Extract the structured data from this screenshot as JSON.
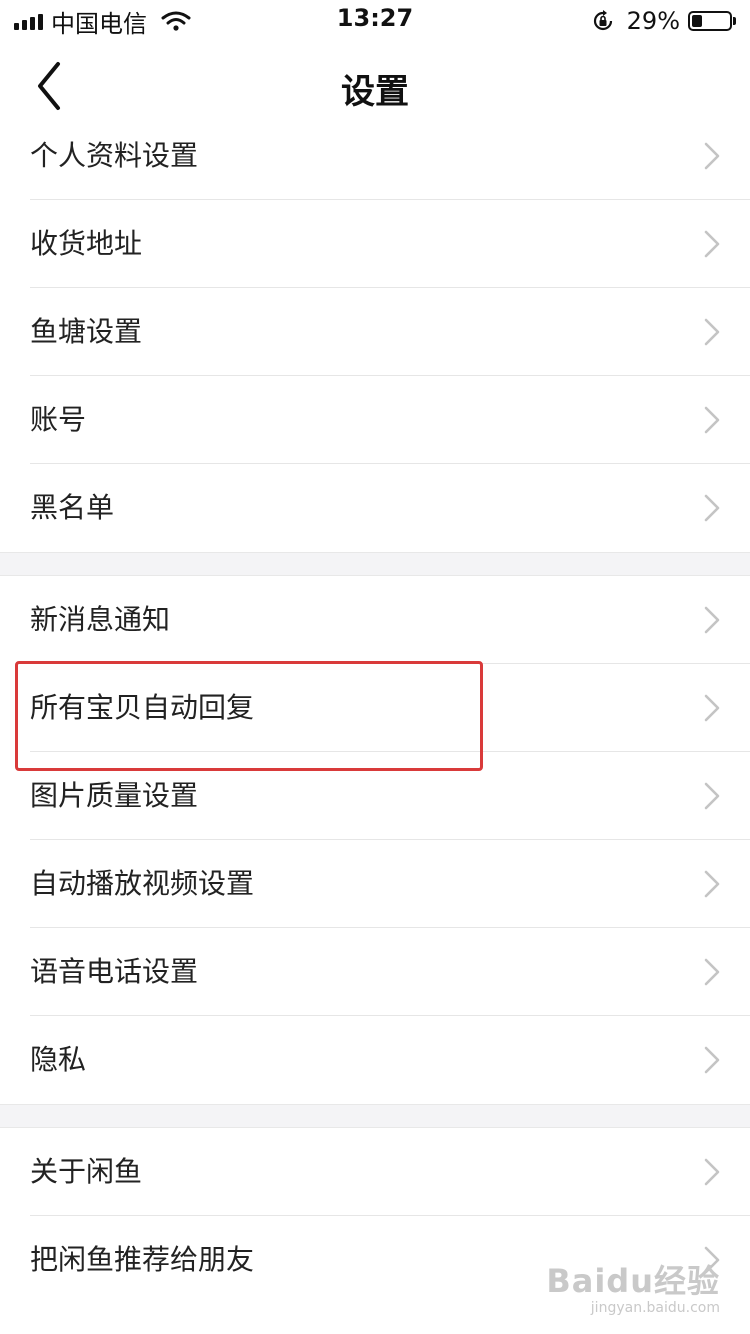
{
  "status_bar": {
    "carrier": "中国电信",
    "time": "13:27",
    "battery_percent": "29%",
    "battery_level": 0.29,
    "icons": [
      "signal-icon",
      "wifi-icon",
      "rotation-lock-icon",
      "battery-icon"
    ]
  },
  "nav": {
    "title": "设置",
    "back_icon": "chevron-left-icon"
  },
  "groups": [
    {
      "items": [
        {
          "label": "个人资料设置"
        },
        {
          "label": "收货地址"
        },
        {
          "label": "鱼塘设置"
        },
        {
          "label": "账号"
        },
        {
          "label": "黑名单"
        }
      ]
    },
    {
      "items": [
        {
          "label": "新消息通知"
        },
        {
          "label": "所有宝贝自动回复"
        },
        {
          "label": "图片质量设置"
        },
        {
          "label": "自动播放视频设置"
        },
        {
          "label": "语音电话设置"
        },
        {
          "label": "隐私"
        }
      ]
    },
    {
      "items": [
        {
          "label": "关于闲鱼"
        },
        {
          "label": "把闲鱼推荐给朋友"
        }
      ]
    }
  ],
  "highlighted_item": "所有宝贝自动回复",
  "colors": {
    "highlight_border": "#d93a3a",
    "section_gap": "#f4f4f6",
    "chevron": "#c4c4c4"
  },
  "watermark": {
    "main": "Baidu经验",
    "sub": "jingyan.baidu.com"
  }
}
